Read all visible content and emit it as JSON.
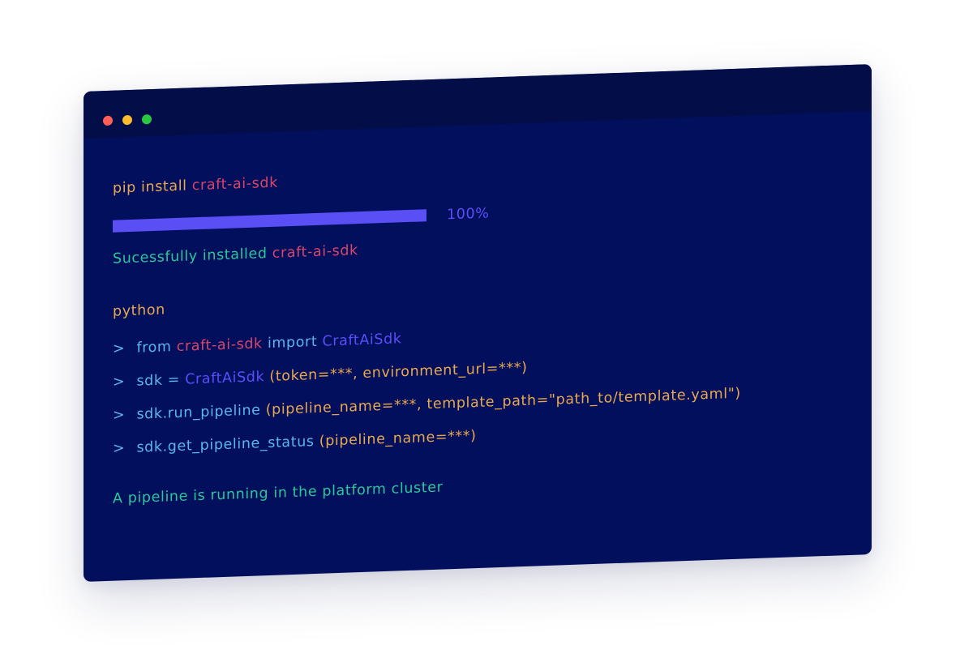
{
  "colors": {
    "window_bg": "#020f5c",
    "titlebar_bg": "#030e48",
    "command": "#e9a94f",
    "package": "#d9466a",
    "success": "#2bc79a",
    "progress": "#5a4ff5",
    "code": "#5cb6ea",
    "class_name": "#5a4ff5",
    "args": "#e9a94f",
    "dot_close": "#ff5f57",
    "dot_minimize": "#ffbd2e",
    "dot_zoom": "#28c940"
  },
  "window_controls": [
    "close",
    "minimize",
    "zoom"
  ],
  "install": {
    "command": "pip install",
    "package": "craft-ai-sdk"
  },
  "progress": {
    "value": 1.0,
    "label": "100%"
  },
  "success": {
    "text": "Sucessfully installed",
    "package": "craft-ai-sdk"
  },
  "python_command": "python",
  "code_lines": [
    {
      "prompt": ">",
      "parts": [
        {
          "text": "from ",
          "role": "code"
        },
        {
          "text": "craft-ai-sdk",
          "role": "package"
        },
        {
          "text": " import ",
          "role": "code"
        },
        {
          "text": "CraftAiSdk",
          "role": "class_name"
        }
      ]
    },
    {
      "prompt": ">",
      "parts": [
        {
          "text": "sdk = ",
          "role": "code"
        },
        {
          "text": "CraftAiSdk",
          "role": "class_name"
        },
        {
          "text": "(token=***, environment_url=***)",
          "role": "args"
        }
      ]
    },
    {
      "prompt": ">",
      "parts": [
        {
          "text": "sdk.run_pipeline",
          "role": "code"
        },
        {
          "text": "(pipeline_name=***, template_path=\"path_to/template.yaml\")",
          "role": "args"
        }
      ]
    },
    {
      "prompt": ">",
      "parts": [
        {
          "text": "sdk.get_pipeline_status",
          "role": "code"
        },
        {
          "text": "(pipeline_name=***)",
          "role": "args"
        }
      ]
    }
  ],
  "status_message": "A pipeline is running in the platform cluster"
}
